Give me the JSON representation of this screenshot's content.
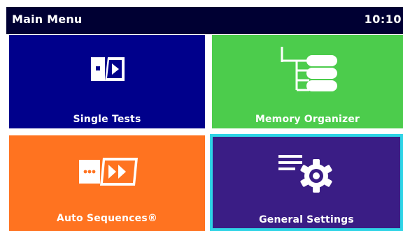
{
  "header": {
    "title": "Main Menu",
    "time": "10:10"
  },
  "tiles": [
    {
      "label": "Single Tests",
      "color": "#00008b",
      "icon": "single-test-icon"
    },
    {
      "label": "Memory Organizer",
      "color": "#4ccc4c",
      "icon": "memory-tree-icon"
    },
    {
      "label": "Auto Sequences®",
      "color": "#ff7320",
      "icon": "auto-sequence-icon"
    },
    {
      "label": "General Settings",
      "color": "#3a1d85",
      "icon": "settings-gear-icon",
      "selected": true
    }
  ],
  "colors": {
    "header_bg": "#000033",
    "selection_border": "#2fd4e6"
  }
}
